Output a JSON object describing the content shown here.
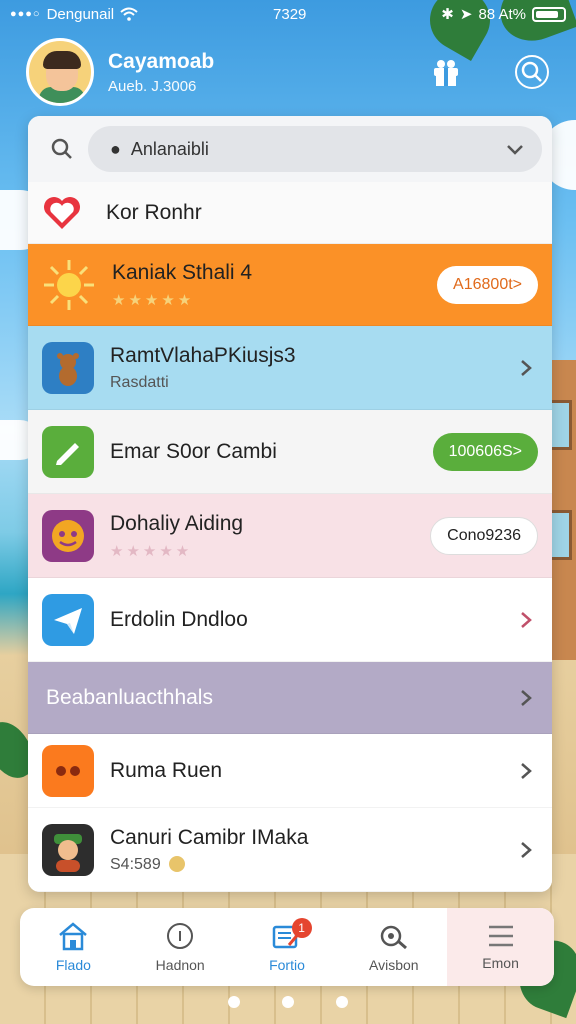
{
  "status_bar": {
    "carrier": "Dengunail",
    "time": "7329",
    "battery_text": "88 At%"
  },
  "profile": {
    "name": "Cayamoab",
    "subtitle": "Aueb. J.3006"
  },
  "search": {
    "label": "Anlanaibli"
  },
  "favorite_row": {
    "title": "Kor Ronhr"
  },
  "featured_row": {
    "title": "Kaniak Sthali 4",
    "stars": "★★★★★",
    "button": "A16800t>"
  },
  "item_blue": {
    "title": "RamtVlahaPKiusjs3",
    "subtitle": "Rasdatti"
  },
  "item_green": {
    "title": "Emar S0or Cambi",
    "button": "100606S>"
  },
  "item_pink": {
    "title": "Dohaliy Aiding",
    "stars": "★★★★★",
    "button": "Cono9236"
  },
  "item_telegram": {
    "title": "Erdolin Dndloo"
  },
  "section_row": {
    "title": "Beabanluacthhals"
  },
  "item_game": {
    "title": "Ruma Ruen"
  },
  "item_user": {
    "title": "Canuri Camibr IMaka",
    "subtitle": "S4:589"
  },
  "bottom_nav": {
    "items": [
      {
        "label": "Flado",
        "icon": "home-icon"
      },
      {
        "label": "Hadnon",
        "icon": "info-icon"
      },
      {
        "label": "Fortio",
        "icon": "compose-icon",
        "badge": "1"
      },
      {
        "label": "Avisbon",
        "icon": "settings-icon"
      },
      {
        "label": "Emon",
        "icon": "menu-icon"
      }
    ]
  },
  "colors": {
    "accent_orange": "#fb9127",
    "accent_green": "#5aae3c",
    "accent_blue": "#2a8ad8",
    "badge_red": "#e5452f"
  }
}
